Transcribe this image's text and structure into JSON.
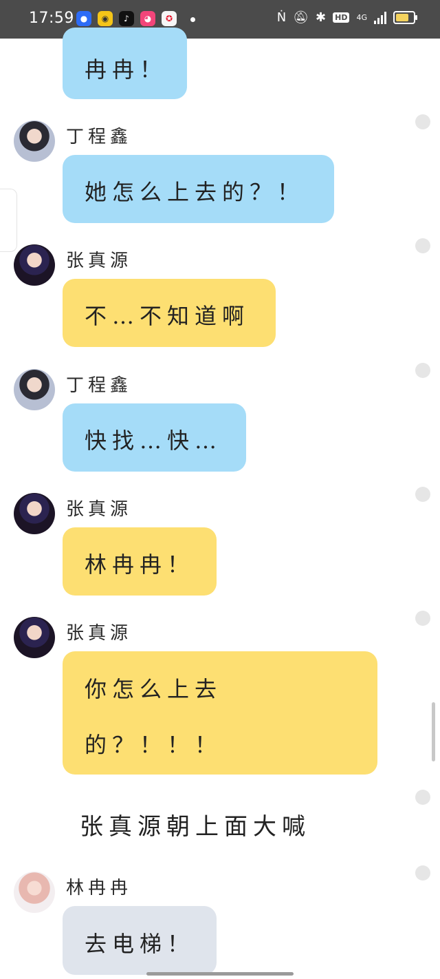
{
  "status_bar": {
    "time": "17:59",
    "apps": [
      "baidu-map-app",
      "ofo-app",
      "tiktok-app",
      "shop-app",
      "weibo-app"
    ],
    "network": "4G",
    "hd": "HD",
    "battery_level": 0.75
  },
  "messages": [
    {
      "speaker": "",
      "text": "冉冉！"
    },
    {
      "speaker": "丁程鑫",
      "text": "她怎么上去的？！"
    },
    {
      "speaker": "张真源",
      "text": "不…不知道啊"
    },
    {
      "speaker": "丁程鑫",
      "text": "快找…快…"
    },
    {
      "speaker": "张真源",
      "text": "林冉冉！"
    },
    {
      "speaker": "张真源",
      "text_line1": "你怎么上去",
      "text_line2": "的？！！！"
    },
    {
      "narration": "张真源朝上面大喊"
    },
    {
      "speaker": "林冉冉",
      "text": "去电梯！"
    }
  ],
  "colors": {
    "blue_bubble": "#a5dcf8",
    "yellow_bubble": "#fddf72",
    "gray_bubble": "#dfe4ec",
    "status_bar": "#4b4b4b"
  }
}
